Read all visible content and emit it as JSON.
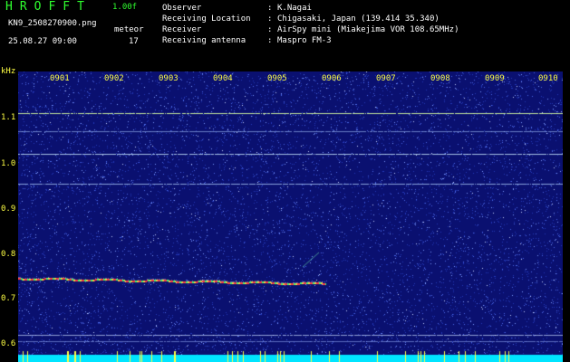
{
  "header": {
    "app_title": "HROFFT",
    "app_version": "1.00f",
    "file_name": "KN9_2508270900.png",
    "mode": "meteor",
    "timestamp": "25.08.27 09:00",
    "count": "17"
  },
  "metadata": [
    {
      "key": "Observer",
      "value": "K.Nagai"
    },
    {
      "key": "Receiving Location",
      "value": "Chigasaki, Japan (139.414 35.340)"
    },
    {
      "key": "Receiver",
      "value": "AirSpy mini (Miakejima VOR 108.65MHz)"
    },
    {
      "key": "Receiving antenna",
      "value": "Maspro FM-3"
    }
  ],
  "plot": {
    "y_unit": "kHz",
    "y_ticks": [
      "1.1",
      "1.0",
      "0.9",
      "0.8",
      "0.7",
      "0.6"
    ],
    "x_ticks": [
      "0901",
      "0902",
      "0903",
      "0904",
      "0905",
      "0906",
      "0907",
      "0908",
      "0909",
      "0910"
    ],
    "colors": {
      "background": "#0a1070",
      "noise_light": "#7f9cff",
      "label": "#ffff44",
      "bottom_bar": "#00e5ff",
      "meteor_echo": "#ff4040"
    }
  }
}
